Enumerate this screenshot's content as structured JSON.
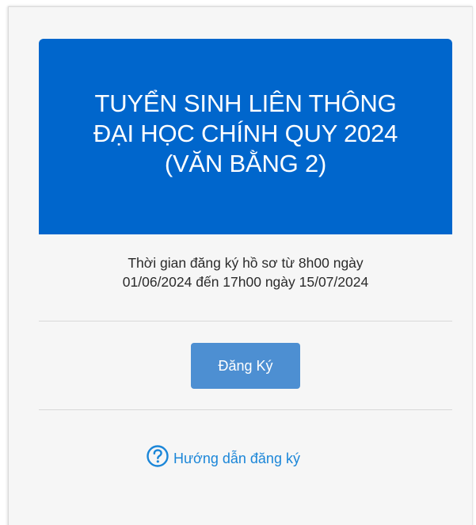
{
  "banner": {
    "title": "TUYỂN SINH LIÊN THÔNG\nĐẠI HỌC CHÍNH QUY 2024\n(VĂN BẰNG 2)",
    "background_color": "#0066cc"
  },
  "registration_period": {
    "text": "Thời gian đăng ký hồ sơ từ 8h00 ngày\n01/06/2024 đến 17h00 ngày 15/07/2024"
  },
  "register_button": {
    "label": "Đăng Ký",
    "color": "#4d8fd2"
  },
  "guide_link": {
    "icon": "question-circle-icon",
    "label": "Hướng dẫn đăng ký",
    "color": "#1b86d8"
  }
}
